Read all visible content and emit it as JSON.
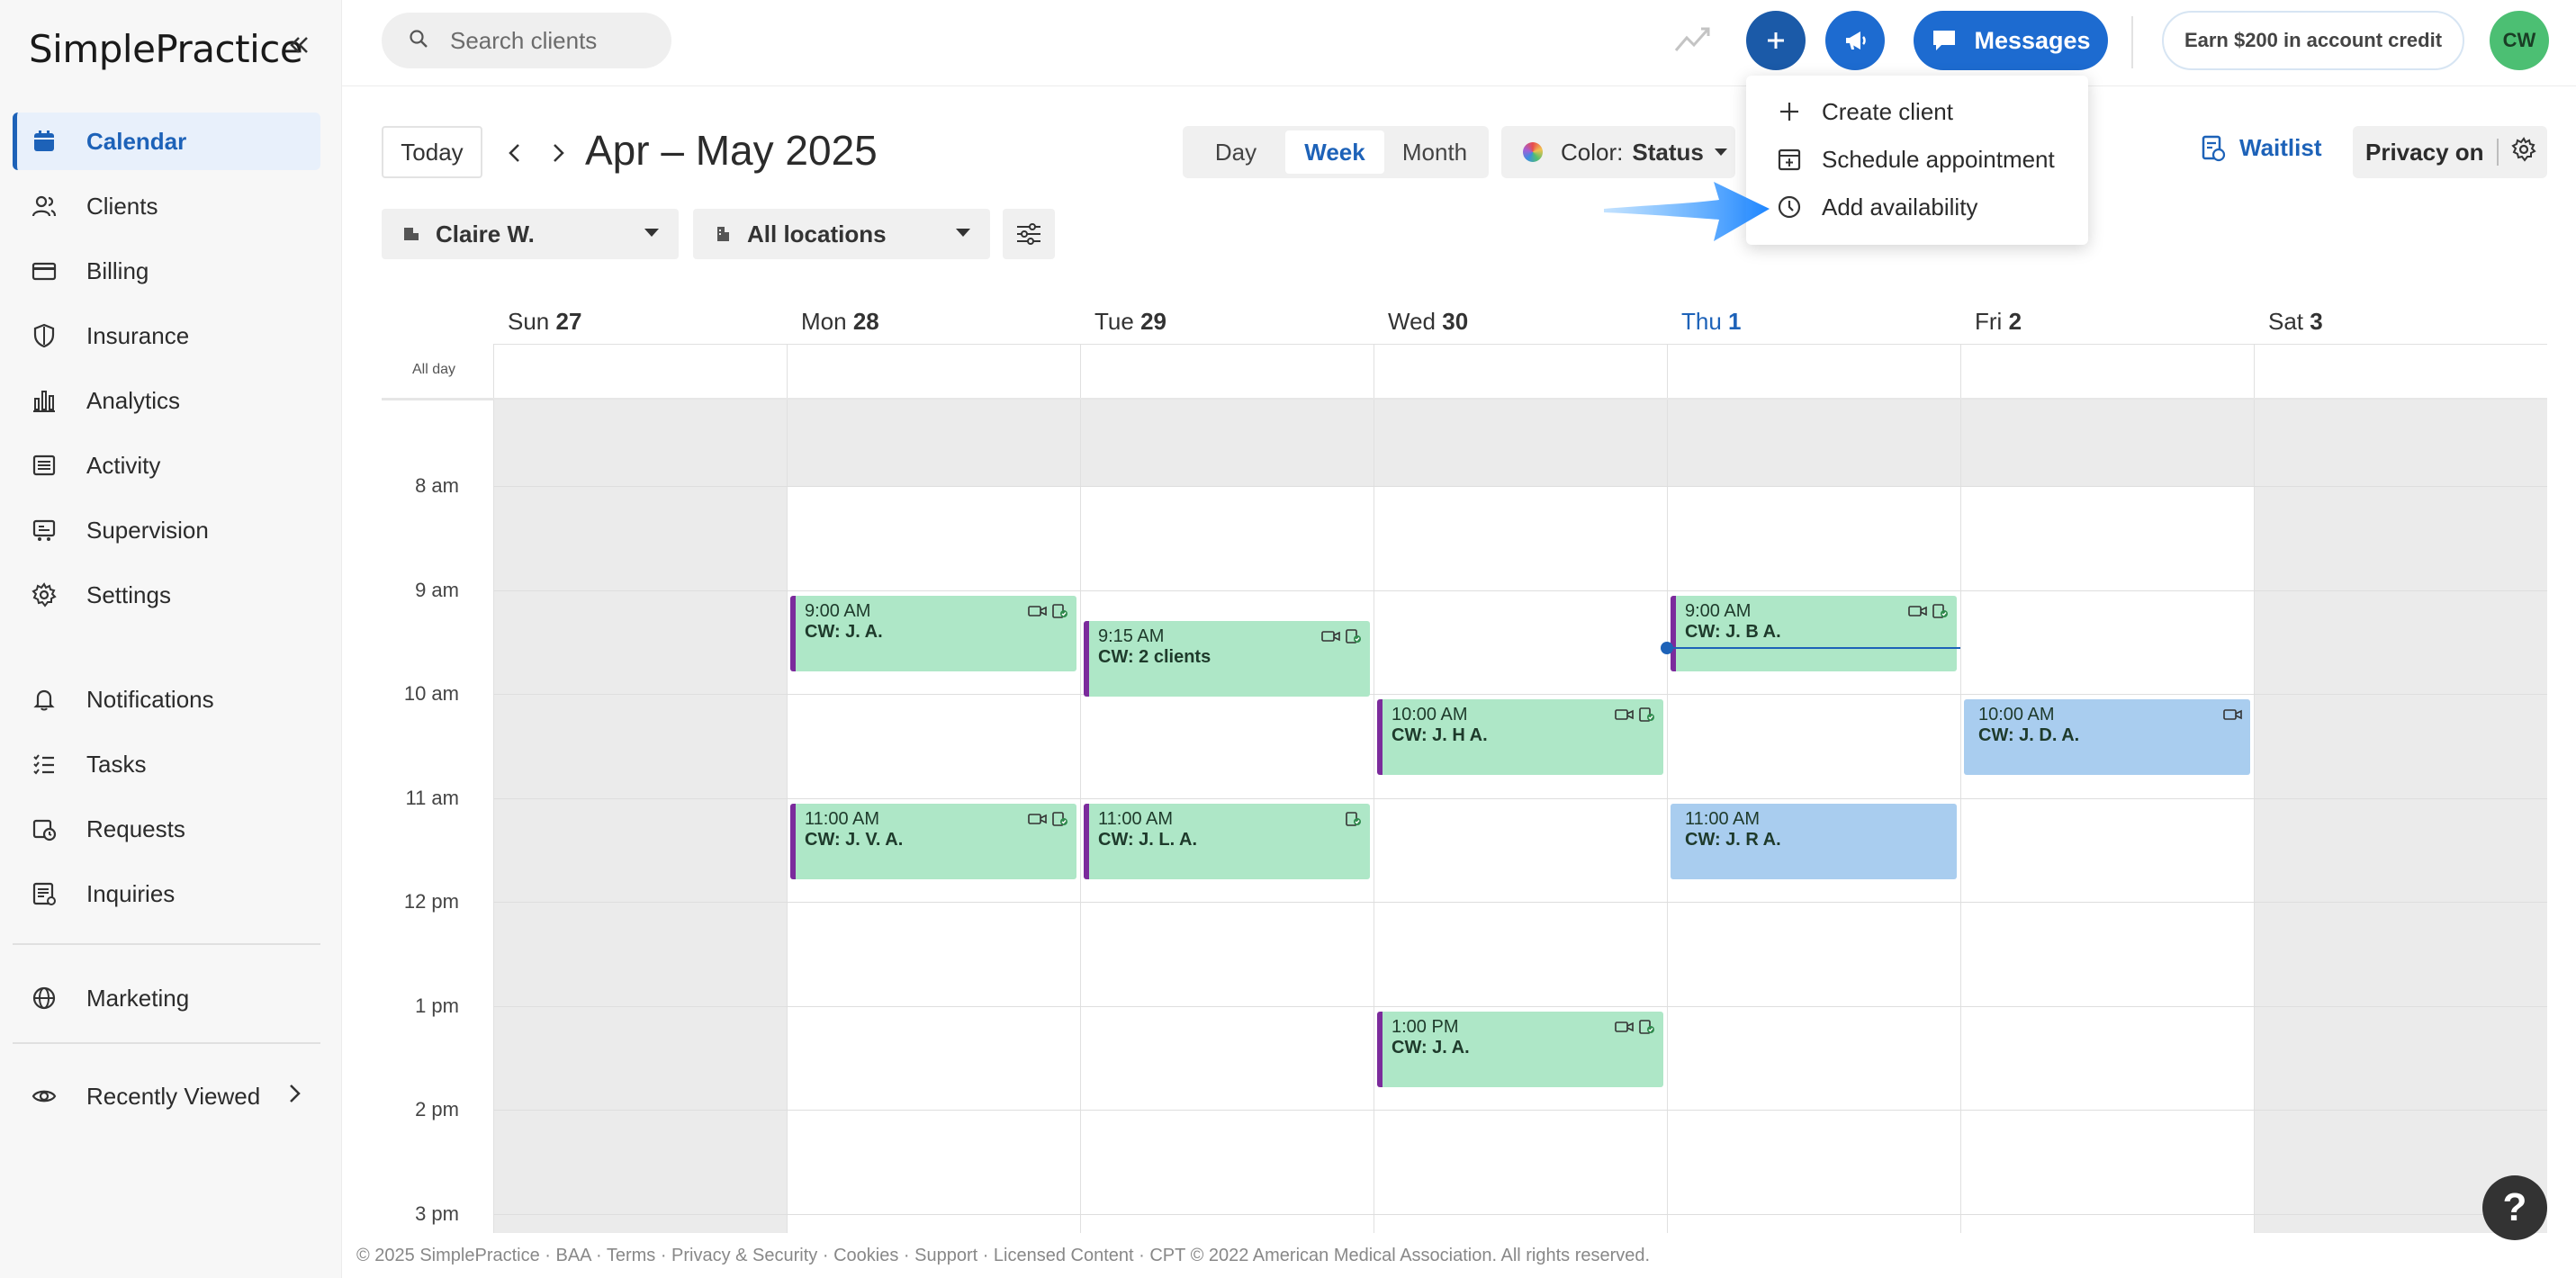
{
  "brand": {
    "logo_text": "SimplePractice",
    "accent": "#1d62b8",
    "plus_button_color": "#1b5aa8"
  },
  "sidebar": {
    "items": [
      {
        "label": "Calendar",
        "icon": "calendar-icon",
        "active": true
      },
      {
        "label": "Clients",
        "icon": "users-icon"
      },
      {
        "label": "Billing",
        "icon": "credit-card-icon"
      },
      {
        "label": "Insurance",
        "icon": "shield-icon"
      },
      {
        "label": "Analytics",
        "icon": "bar-chart-icon"
      },
      {
        "label": "Activity",
        "icon": "list-icon"
      },
      {
        "label": "Supervision",
        "icon": "supervision-icon"
      },
      {
        "label": "Settings",
        "icon": "gear-icon"
      },
      {
        "label": "Notifications",
        "icon": "bell-icon"
      },
      {
        "label": "Tasks",
        "icon": "tasks-icon"
      },
      {
        "label": "Requests",
        "icon": "requests-icon"
      },
      {
        "label": "Inquiries",
        "icon": "inquiries-icon"
      },
      {
        "label": "Marketing",
        "icon": "globe-icon"
      },
      {
        "label": "Recently Viewed",
        "icon": "eye-icon"
      }
    ]
  },
  "header": {
    "search_placeholder": "Search clients",
    "messages_label": "Messages",
    "earn_label": "Earn $200 in account credit",
    "avatar_initials": "CW"
  },
  "toolbar": {
    "today_label": "Today",
    "date_range": "Apr – May 2025",
    "views": [
      "Day",
      "Week",
      "Month"
    ],
    "active_view": "Week",
    "color_label": "Color:",
    "color_value": "Status",
    "waitlist_label": "Waitlist",
    "privacy_label": "Privacy on",
    "clinician_filter": "Claire W.",
    "location_filter": "All locations"
  },
  "dropdown": {
    "items": [
      {
        "label": "Create client",
        "icon": "plus-icon"
      },
      {
        "label": "Schedule appointment",
        "icon": "calendar-plus-icon"
      },
      {
        "label": "Add availability",
        "icon": "clock-icon"
      }
    ]
  },
  "calendar": {
    "all_day_label": "All day",
    "days": [
      {
        "name": "Sun",
        "num": "27"
      },
      {
        "name": "Mon",
        "num": "28"
      },
      {
        "name": "Tue",
        "num": "29"
      },
      {
        "name": "Wed",
        "num": "30"
      },
      {
        "name": "Thu",
        "num": "1",
        "today": true
      },
      {
        "name": "Fri",
        "num": "2"
      },
      {
        "name": "Sat",
        "num": "3"
      }
    ],
    "hours": [
      "8 am",
      "9 am",
      "10 am",
      "11 am",
      "12 pm",
      "1 pm",
      "2 pm",
      "3 pm"
    ],
    "appointments": [
      {
        "day": 1,
        "time": "9:00 AM",
        "name": "CW: J. A.",
        "color": "green",
        "icons": [
          "video-icon",
          "client-portal-icon"
        ]
      },
      {
        "day": 2,
        "time": "9:15 AM",
        "name": "CW: 2 clients",
        "color": "green",
        "icons": [
          "video-icon",
          "client-portal-icon"
        ]
      },
      {
        "day": 4,
        "time": "9:00 AM",
        "name": "CW: J. B A.",
        "color": "green",
        "icons": [
          "video-icon",
          "client-portal-icon"
        ]
      },
      {
        "day": 3,
        "time": "10:00 AM",
        "name": "CW: J. H A.",
        "color": "green",
        "icons": [
          "video-icon",
          "client-portal-icon"
        ]
      },
      {
        "day": 5,
        "time": "10:00 AM",
        "name": "CW: J. D. A.",
        "color": "blue",
        "icons": [
          "video-icon"
        ]
      },
      {
        "day": 1,
        "time": "11:00 AM",
        "name": "CW: J. V. A.",
        "color": "green",
        "icons": [
          "video-icon",
          "client-portal-icon"
        ]
      },
      {
        "day": 2,
        "time": "11:00 AM",
        "name": "CW: J. L. A.",
        "color": "green",
        "icons": [
          "client-portal-icon"
        ]
      },
      {
        "day": 4,
        "time": "11:00 AM",
        "name": "CW: J. R A.",
        "color": "blue",
        "icons": []
      },
      {
        "day": 3,
        "time": "1:00 PM",
        "name": "CW: J. A.",
        "color": "green",
        "icons": [
          "video-icon",
          "client-portal-icon"
        ]
      }
    ]
  },
  "footer": {
    "text": "© 2025 SimplePractice · BAA · Terms · Privacy & Security · Cookies · Support · Licensed Content · CPT © 2022 American Medical Association. All rights reserved."
  },
  "help_label": "?"
}
